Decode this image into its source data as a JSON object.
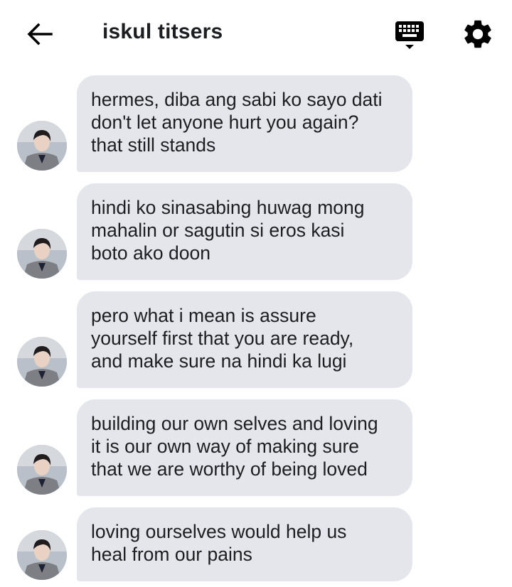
{
  "header": {
    "title": "iskul titsers",
    "back_icon": "arrow-left-icon",
    "keyboard_icon": "keyboard-icon",
    "settings_icon": "gear-icon"
  },
  "messages": [
    {
      "text": "hermes, diba ang sabi ko sayo dati\ndon't let anyone hurt you again?\nthat still stands"
    },
    {
      "text": "hindi ko sinasabing huwag mong\nmahalin or sagutin si eros kasi\nboto ako doon"
    },
    {
      "text": "pero what i mean is assure\nyourself first that you are ready,\nand make sure na hindi ka lugi"
    },
    {
      "text": "building our own selves and loving\nit is our own way of making sure\nthat we are worthy of being loved"
    },
    {
      "text": "loving ourselves would help us\nheal from our pains"
    }
  ],
  "colors": {
    "bubble": "#e4e6eb",
    "text": "#1c1e21",
    "background": "#ffffff"
  }
}
